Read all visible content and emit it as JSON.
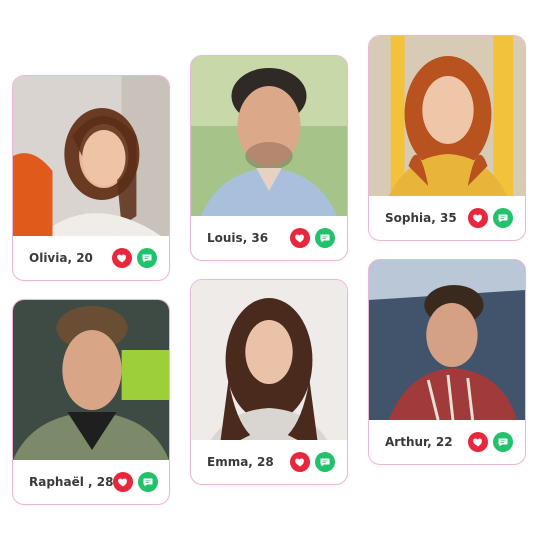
{
  "colors": {
    "like": "#e8263c",
    "chat": "#22c16b",
    "border": "#e8b9d6"
  },
  "icons": {
    "like": "heart-icon",
    "chat": "chat-bubble-icon"
  },
  "profiles": [
    {
      "name": "Olivia, 20"
    },
    {
      "name": "Louis, 36"
    },
    {
      "name": "Sophia, 35"
    },
    {
      "name": "Raphaël , 28"
    },
    {
      "name": "Emma, 28"
    },
    {
      "name": "Arthur, 22"
    }
  ]
}
